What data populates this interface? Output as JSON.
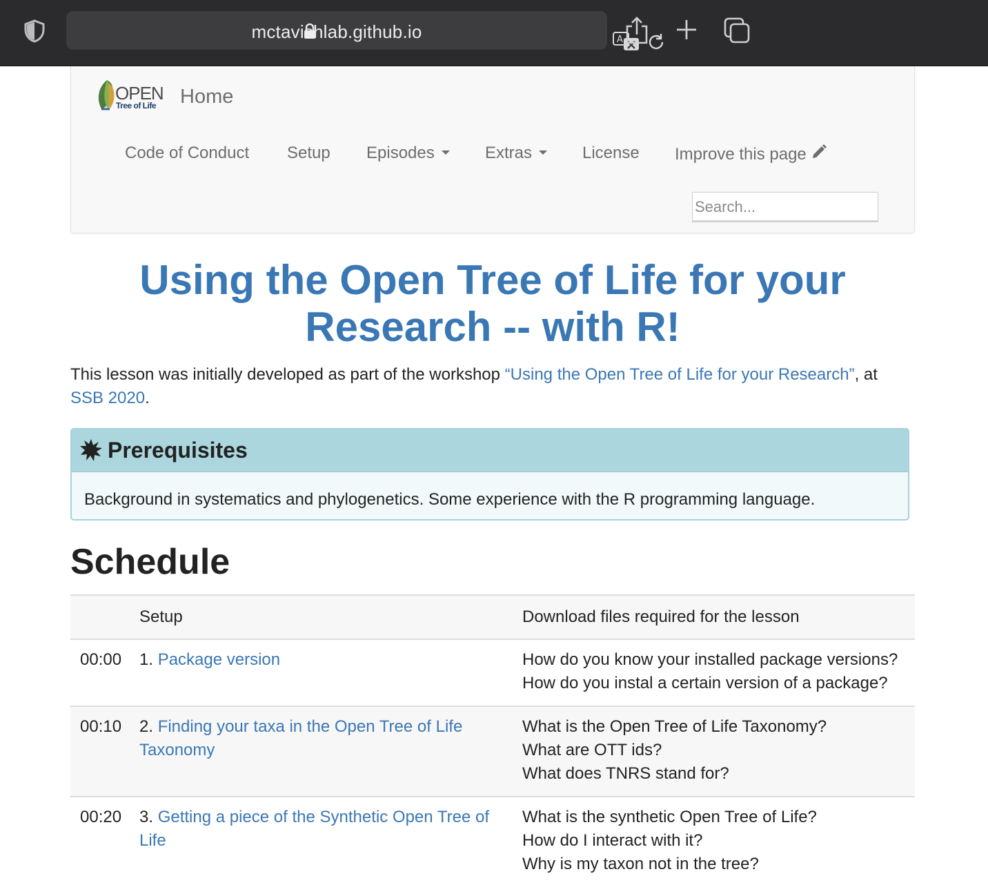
{
  "browser": {
    "url": "mctavishlab.github.io"
  },
  "navbar": {
    "logo_text_top": "OPEN",
    "logo_text_bottom": "Tree of Life",
    "brand": "Home",
    "items": [
      {
        "label": "Code of Conduct"
      },
      {
        "label": "Setup"
      },
      {
        "label": "Episodes"
      },
      {
        "label": "Extras"
      },
      {
        "label": "License"
      },
      {
        "label": "Improve this page"
      }
    ],
    "search_placeholder": "Search..."
  },
  "page": {
    "title": "Using the Open Tree of Life for your Research -- with R!",
    "intro_prefix": "This lesson was initially developed as part of the workshop ",
    "intro_link": "“Using the Open Tree of Life for your Research”",
    "intro_mid": ", at ",
    "intro_link2": "SSB 2020",
    "intro_suffix": "."
  },
  "prerequisites": {
    "title": "Prerequisites",
    "body": "Background in systematics and phylogenetics. Some experience with the R programming language."
  },
  "schedule": {
    "heading": "Schedule",
    "setup_row": {
      "label": "Setup",
      "description": "Download files required for the lesson"
    },
    "rows": [
      {
        "time": "00:00",
        "number": "1.",
        "episode": "Package version",
        "questions": [
          "How do you know your installed package versions?",
          "How do you instal a certain version of a package?"
        ]
      },
      {
        "time": "00:10",
        "number": "2.",
        "episode": "Finding your taxa in the Open Tree of Life Taxonomy",
        "questions": [
          "What is the Open Tree of Life Taxonomy?",
          "What are OTT ids?",
          "What does TNRS stand for?"
        ]
      },
      {
        "time": "00:20",
        "number": "3.",
        "episode": "Getting a piece of the Synthetic Open Tree of Life",
        "questions": [
          "What is the synthetic Open Tree of Life?",
          "How do I interact with it?",
          "Why is my taxon not in the tree?"
        ]
      }
    ]
  }
}
